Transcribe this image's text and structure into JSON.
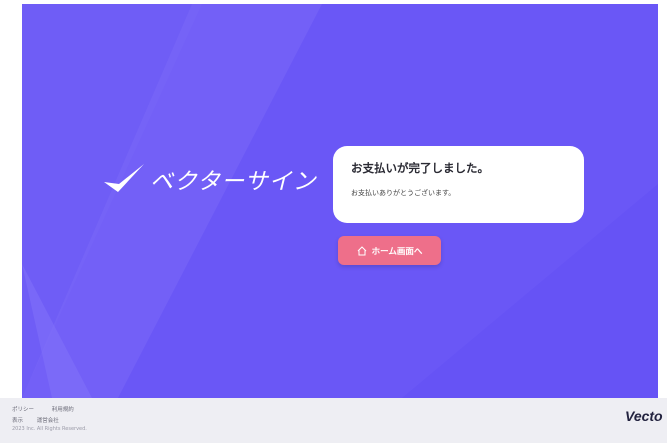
{
  "brand": {
    "logo_text": "ベクターサイン",
    "footer_brand": "Vecto"
  },
  "card": {
    "title": "お支払いが完了しました。",
    "text": "お支払いありがとうございます。"
  },
  "home_button": {
    "label": "ホーム画面へ",
    "icon": "home-icon"
  },
  "footer": {
    "row1": [
      "ポリシー",
      "利用規約"
    ],
    "row2": [
      "表示",
      "運営会社"
    ],
    "copyright": "2023 Inc. All Rights Reserved."
  },
  "colors": {
    "hero_background": "#6a57f6",
    "button": "#ee6f8a",
    "footer_background": "#eeeef3"
  }
}
